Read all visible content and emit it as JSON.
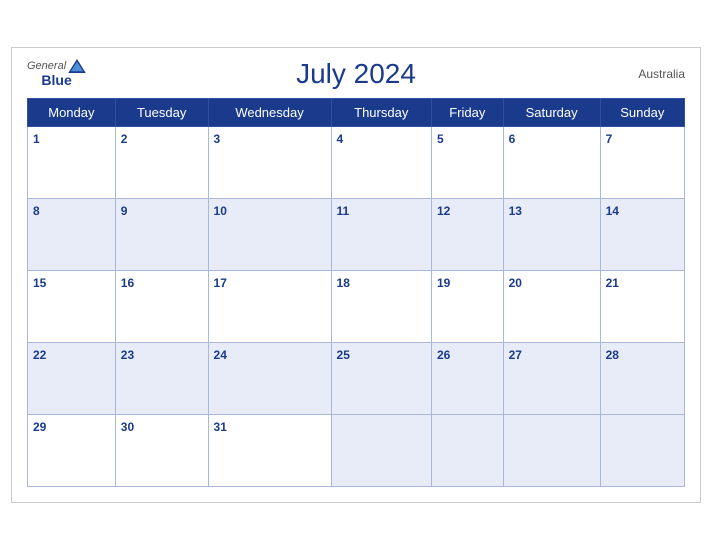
{
  "header": {
    "title": "July 2024",
    "country": "Australia",
    "logo_general": "General",
    "logo_blue": "Blue"
  },
  "days_of_week": [
    "Monday",
    "Tuesday",
    "Wednesday",
    "Thursday",
    "Friday",
    "Saturday",
    "Sunday"
  ],
  "weeks": [
    {
      "shade": false,
      "days": [
        {
          "num": "1",
          "empty": false
        },
        {
          "num": "2",
          "empty": false
        },
        {
          "num": "3",
          "empty": false
        },
        {
          "num": "4",
          "empty": false
        },
        {
          "num": "5",
          "empty": false
        },
        {
          "num": "6",
          "empty": false
        },
        {
          "num": "7",
          "empty": false
        }
      ]
    },
    {
      "shade": true,
      "days": [
        {
          "num": "8",
          "empty": false
        },
        {
          "num": "9",
          "empty": false
        },
        {
          "num": "10",
          "empty": false
        },
        {
          "num": "11",
          "empty": false
        },
        {
          "num": "12",
          "empty": false
        },
        {
          "num": "13",
          "empty": false
        },
        {
          "num": "14",
          "empty": false
        }
      ]
    },
    {
      "shade": false,
      "days": [
        {
          "num": "15",
          "empty": false
        },
        {
          "num": "16",
          "empty": false
        },
        {
          "num": "17",
          "empty": false
        },
        {
          "num": "18",
          "empty": false
        },
        {
          "num": "19",
          "empty": false
        },
        {
          "num": "20",
          "empty": false
        },
        {
          "num": "21",
          "empty": false
        }
      ]
    },
    {
      "shade": true,
      "days": [
        {
          "num": "22",
          "empty": false
        },
        {
          "num": "23",
          "empty": false
        },
        {
          "num": "24",
          "empty": false
        },
        {
          "num": "25",
          "empty": false
        },
        {
          "num": "26",
          "empty": false
        },
        {
          "num": "27",
          "empty": false
        },
        {
          "num": "28",
          "empty": false
        }
      ]
    },
    {
      "shade": false,
      "days": [
        {
          "num": "29",
          "empty": false
        },
        {
          "num": "30",
          "empty": false
        },
        {
          "num": "31",
          "empty": false
        },
        {
          "num": "",
          "empty": true
        },
        {
          "num": "",
          "empty": true
        },
        {
          "num": "",
          "empty": true
        },
        {
          "num": "",
          "empty": true
        }
      ]
    }
  ],
  "accent_color": "#1a3a8c"
}
